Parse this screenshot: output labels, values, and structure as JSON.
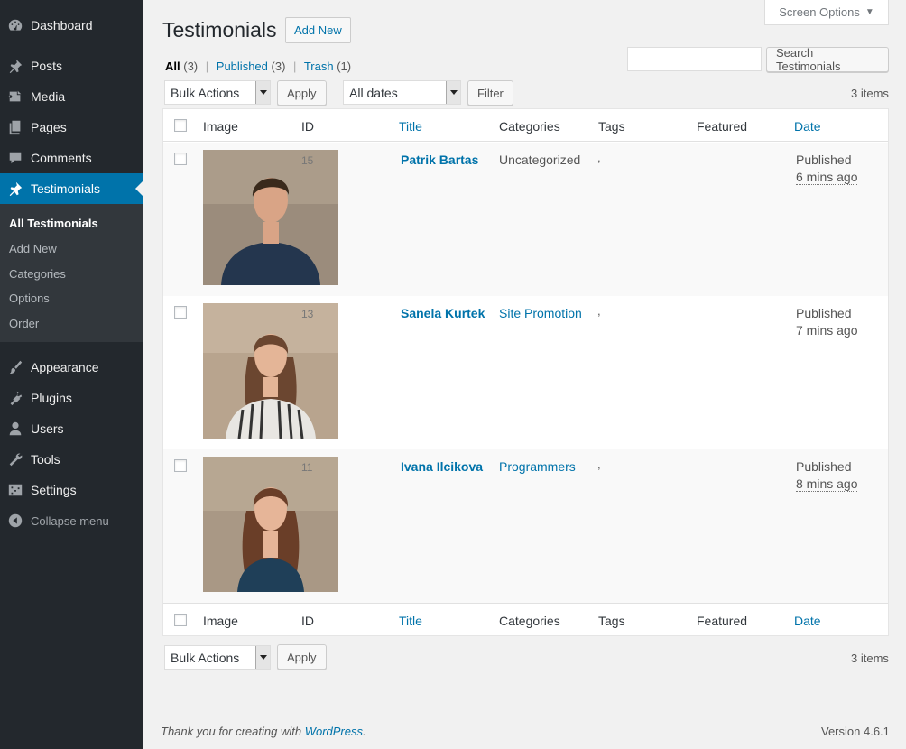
{
  "sidebar": {
    "items": [
      {
        "label": "Dashboard",
        "icon": "dashboard-icon"
      },
      {
        "label": "Posts",
        "icon": "pin-icon"
      },
      {
        "label": "Media",
        "icon": "media-icon"
      },
      {
        "label": "Pages",
        "icon": "pages-icon"
      },
      {
        "label": "Comments",
        "icon": "comment-icon"
      },
      {
        "label": "Testimonials",
        "icon": "pin-icon"
      },
      {
        "label": "Appearance",
        "icon": "brush-icon"
      },
      {
        "label": "Plugins",
        "icon": "plug-icon"
      },
      {
        "label": "Users",
        "icon": "user-icon"
      },
      {
        "label": "Tools",
        "icon": "wrench-icon"
      },
      {
        "label": "Settings",
        "icon": "sliders-icon"
      }
    ],
    "submenu": [
      "All Testimonials",
      "Add New",
      "Categories",
      "Options",
      "Order"
    ],
    "collapse_label": "Collapse menu"
  },
  "header": {
    "title": "Testimonials",
    "add_new": "Add New",
    "screen_options": "Screen Options"
  },
  "views": {
    "all": "All",
    "all_count": "(3)",
    "published": "Published",
    "published_count": "(3)",
    "trash": "Trash",
    "trash_count": "(1)"
  },
  "search": {
    "button": "Search Testimonials",
    "value": ""
  },
  "toolbar": {
    "bulk_actions": "Bulk Actions",
    "apply": "Apply",
    "dates": "All dates",
    "filter": "Filter",
    "items_count": "3 items"
  },
  "table": {
    "columns": [
      "Image",
      "ID",
      "Title",
      "Categories",
      "Tags",
      "Featured",
      "Date"
    ],
    "rows": [
      {
        "id": "15",
        "title": "Patrik Bartas",
        "category": "Uncategorized",
        "tags": ",",
        "status": "Published",
        "ago": "6 mins ago",
        "palette": {
          "bg": "#9b8c7c",
          "hair": "#3a2a1c",
          "skin": "#d9a486",
          "shirt": "#24364e"
        }
      },
      {
        "id": "13",
        "title": "Sanela Kurtek",
        "category": "Site Promotion",
        "tags": ",",
        "status": "Published",
        "ago": "7 mins ago",
        "palette": {
          "bg": "#b8a48e",
          "hair": "#6b4630",
          "skin": "#e4b597",
          "shirt": "#e8e6e2"
        }
      },
      {
        "id": "11",
        "title": "Ivana Ilcikova",
        "category": "Programmers",
        "tags": ",",
        "status": "Published",
        "ago": "8 mins ago",
        "palette": {
          "bg": "#a99885",
          "hair": "#6a3e28",
          "skin": "#e6b598",
          "shirt": "#1f3f58"
        }
      }
    ]
  },
  "footer": {
    "thanks_prefix": "Thank you for creating with ",
    "wordpress": "WordPress",
    "thanks_suffix": ".",
    "version": "Version 4.6.1"
  }
}
